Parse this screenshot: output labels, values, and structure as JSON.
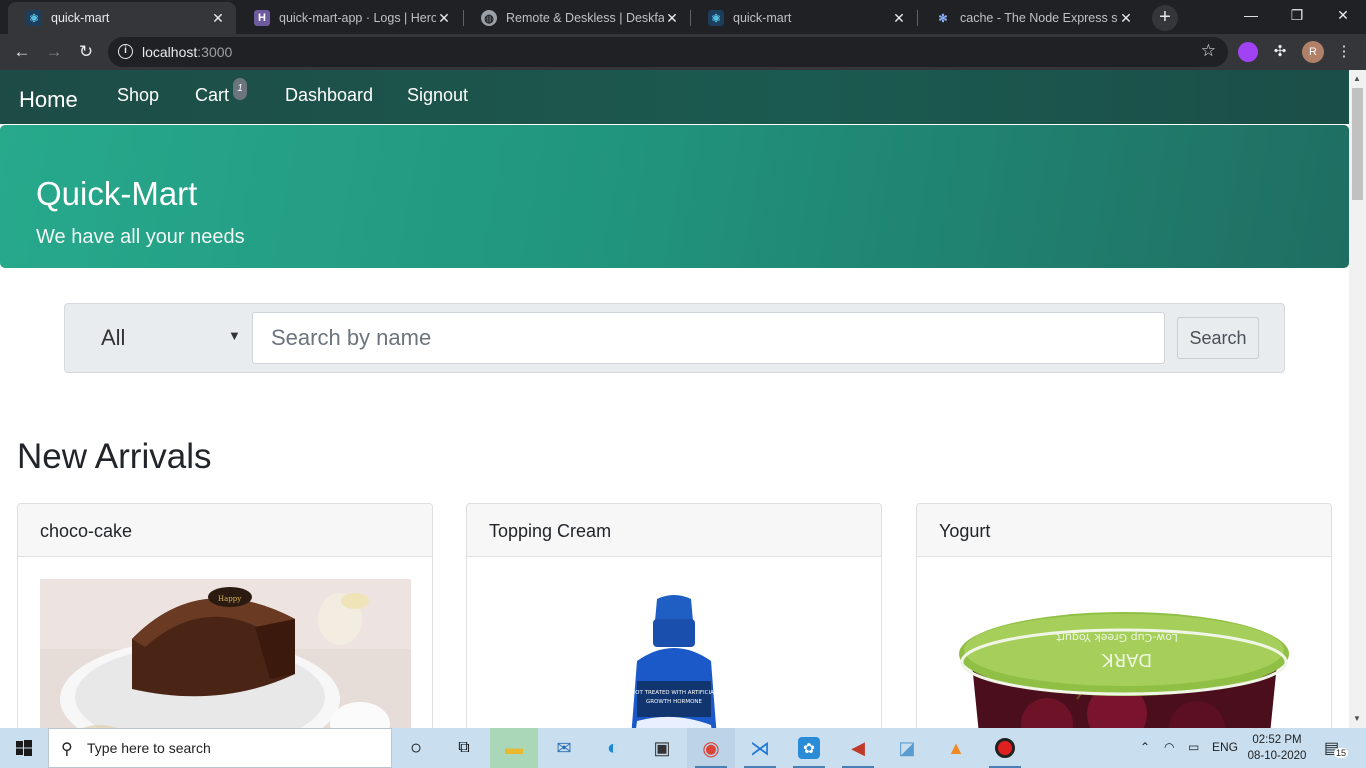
{
  "browser": {
    "tabs": [
      {
        "title": "quick-mart",
        "active": true,
        "icon": "react-icon"
      },
      {
        "title": "quick-mart-app · Logs | Heroku",
        "active": false,
        "icon": "heroku-icon"
      },
      {
        "title": "Remote & Deskless | Deskfactory",
        "active": false,
        "icon": "globe-icon"
      },
      {
        "title": "quick-mart",
        "active": false,
        "icon": "react-icon"
      },
      {
        "title": "cache - The Node Express server",
        "active": false,
        "icon": "node-icon"
      }
    ],
    "url_host": "localhost",
    "url_port": ":3000",
    "profile_initial": "R"
  },
  "navbar": {
    "brand": "Home",
    "links": [
      "Shop",
      "Cart",
      "Dashboard",
      "Signout"
    ],
    "cart_count": "1"
  },
  "jumbotron": {
    "title": "Quick-Mart",
    "subtitle": "We have all your needs"
  },
  "search": {
    "category": "All",
    "placeholder": "Search by name",
    "button_label": "Search"
  },
  "section": {
    "title": "New Arrivals"
  },
  "products": [
    {
      "name": "choco-cake"
    },
    {
      "name": "Topping Cream"
    },
    {
      "name": "Yogurt"
    }
  ],
  "taskbar": {
    "search_placeholder": "Type here to search",
    "language": "ENG",
    "time": "02:52 PM",
    "date": "08-10-2020",
    "notification_count": "15"
  },
  "colors": {
    "navbar": "#1b5a50",
    "jumbotron_start": "#27a98c",
    "jumbotron_end": "#1f6e62",
    "chrome_dark": "#202124"
  }
}
